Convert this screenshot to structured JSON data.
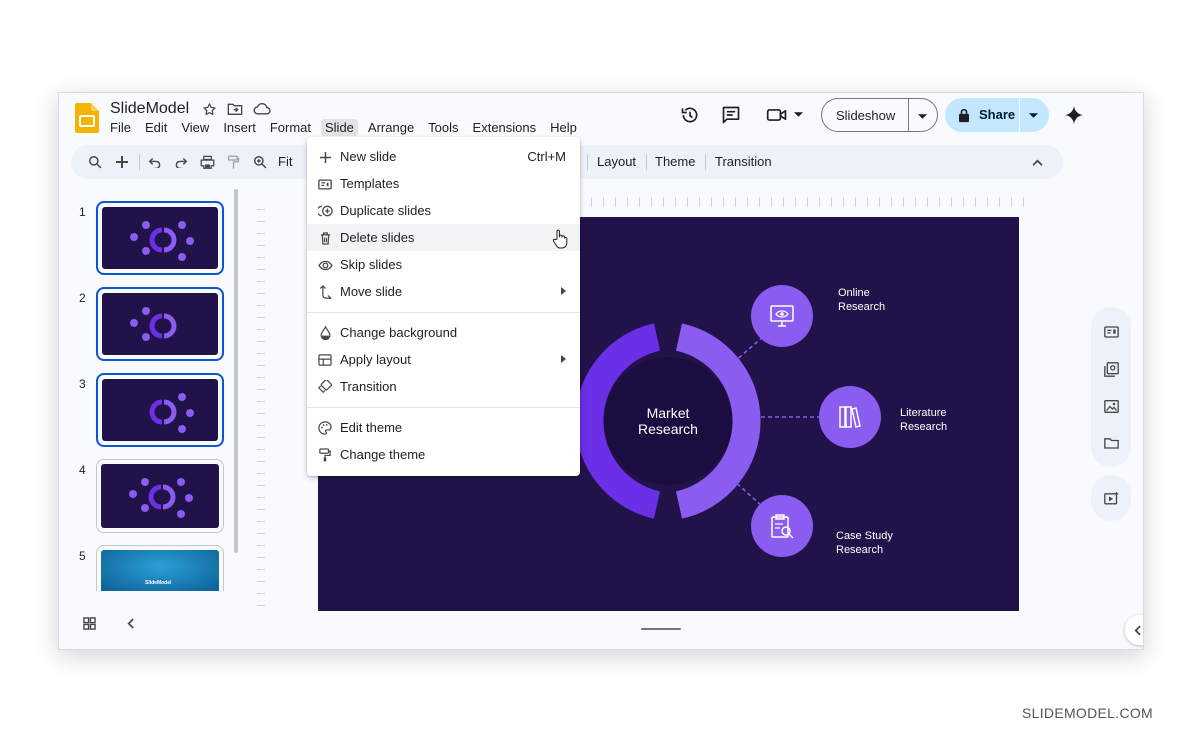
{
  "app": {
    "doc_title": "SlideModel",
    "menus": [
      "File",
      "Edit",
      "View",
      "Insert",
      "Format",
      "Slide",
      "Arrange",
      "Tools",
      "Extensions",
      "Help"
    ],
    "slideshow_label": "Slideshow",
    "share_label": "Share"
  },
  "toolbar": {
    "zoom_label": "Fit",
    "layout_label": "Layout",
    "theme_label": "Theme",
    "transition_label": "Transition"
  },
  "slide_menu": {
    "items": [
      {
        "label": "New slide",
        "shortcut": "Ctrl+M",
        "icon": "plus-icon"
      },
      {
        "label": "Templates",
        "icon": "templates-icon"
      },
      {
        "label": "Duplicate slides",
        "icon": "duplicate-icon"
      },
      {
        "label": "Delete slides",
        "icon": "trash-icon"
      },
      {
        "label": "Skip slides",
        "icon": "eye-icon"
      },
      {
        "label": "Move slide",
        "icon": "move-icon"
      },
      {
        "label": "Change background",
        "icon": "droplet-icon"
      },
      {
        "label": "Apply layout",
        "icon": "layout-icon"
      },
      {
        "label": "Transition",
        "icon": "transition-icon"
      },
      {
        "label": "Edit theme",
        "icon": "palette-icon"
      },
      {
        "label": "Change theme",
        "icon": "paint-roller-icon"
      }
    ],
    "hovered_item": "Delete slides"
  },
  "filmstrip": {
    "slide_numbers": [
      "1",
      "2",
      "3",
      "4",
      "5"
    ],
    "selected": [
      "1",
      "2",
      "3"
    ],
    "thumb_title": "Market Research",
    "thumb5_brand": "SlideModel"
  },
  "slide": {
    "center_title": "Market\nResearch",
    "nodes": [
      {
        "label": "Online\nResearch",
        "icon": "monitor-eye-icon"
      },
      {
        "label": "Literature\nResearch",
        "icon": "books-icon"
      },
      {
        "label": "Case Study\nResearch",
        "icon": "clipboard-search-icon"
      }
    ]
  },
  "colors": {
    "slide_bg": "#22124a",
    "ring_dark": "#6a2fe6",
    "ring_light": "#8a5cf0",
    "accent_blue": "#0b57d0",
    "share_bg": "#c2e7ff"
  },
  "watermark": "SLIDEMODEL.COM"
}
